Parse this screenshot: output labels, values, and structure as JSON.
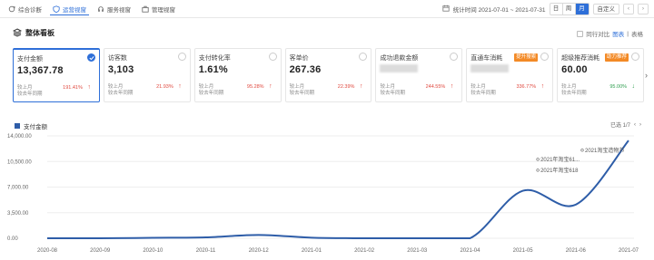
{
  "nav": {
    "tabs": [
      {
        "label": "综合诊断",
        "icon": "refresh-icon"
      },
      {
        "label": "运营视窗",
        "icon": "shield-icon",
        "active": true
      },
      {
        "label": "服务视窗",
        "icon": "headset-icon"
      },
      {
        "label": "管理视窗",
        "icon": "briefcase-icon"
      }
    ],
    "date_label": "统计时间 2021-07-01 ~ 2021-07-31",
    "periods": [
      "日",
      "周",
      "月"
    ],
    "active_period": "月",
    "custom_label": "自定义",
    "prev_label": "‹",
    "next_label": "›"
  },
  "section": {
    "title": "整体看板",
    "compare_label": "同行对比",
    "chart_link": "图表",
    "table_link": "表格",
    "divider": "|"
  },
  "cards": [
    {
      "name": "支付金额",
      "value": "13,367.78",
      "cmp1": "较上月",
      "cmp2": "较去年同期",
      "pct": "191.41%",
      "dir": "up",
      "active": true
    },
    {
      "name": "访客数",
      "value": "3,103",
      "cmp1": "较上月",
      "cmp2": "较去年同期",
      "pct": "21.93%",
      "dir": "up"
    },
    {
      "name": "支付转化率",
      "value": "1.61%",
      "cmp1": "较上月",
      "cmp2": "较去年同期",
      "pct": "95.28%",
      "dir": "up"
    },
    {
      "name": "客单价",
      "value": "267.36",
      "cmp1": "较上月",
      "cmp2": "较去年同期",
      "pct": "22.39%",
      "dir": "up"
    },
    {
      "name": "成功退款金额",
      "value": "",
      "cmp1": "较上月",
      "cmp2": "较去年同期",
      "pct": "244.55%",
      "dir": "up",
      "blurred": true
    },
    {
      "name": "直通车消耗",
      "value": "",
      "cmp1": "较上月",
      "cmp2": "较去年同期",
      "pct": "336.77%",
      "dir": "up",
      "badge": "提升搜索",
      "blurred": true
    },
    {
      "name": "超级推荐消耗",
      "value": "60.00",
      "cmp1": "较上月",
      "cmp2": "较去年同期",
      "pct": "95.00%",
      "dir": "down",
      "badge": "助力推荐"
    }
  ],
  "chart_legend": "支付金额",
  "pager": {
    "text": "已选 1/7",
    "prev": "‹",
    "next": "›"
  },
  "chart_data": {
    "type": "line",
    "x": [
      "2020-08",
      "2020-09",
      "2020-10",
      "2020-11",
      "2020-12",
      "2021-01",
      "2021-02",
      "2021-03",
      "2021-04",
      "2021-05",
      "2021-06",
      "2021-07"
    ],
    "series": [
      {
        "name": "支付金额",
        "values": [
          0,
          0,
          60,
          120,
          450,
          80,
          0,
          0,
          0,
          6500,
          4600,
          13367.78
        ]
      }
    ],
    "yticks": [
      "0.00",
      "3,500.00",
      "7,000.00",
      "10,500.00",
      "14,000.00"
    ],
    "ylim": [
      0,
      14000
    ],
    "annotations": [
      "2021年淘宝61...",
      "2021年淘宝618",
      "2021淘宝造物节"
    ],
    "color": "#2e5da8"
  }
}
